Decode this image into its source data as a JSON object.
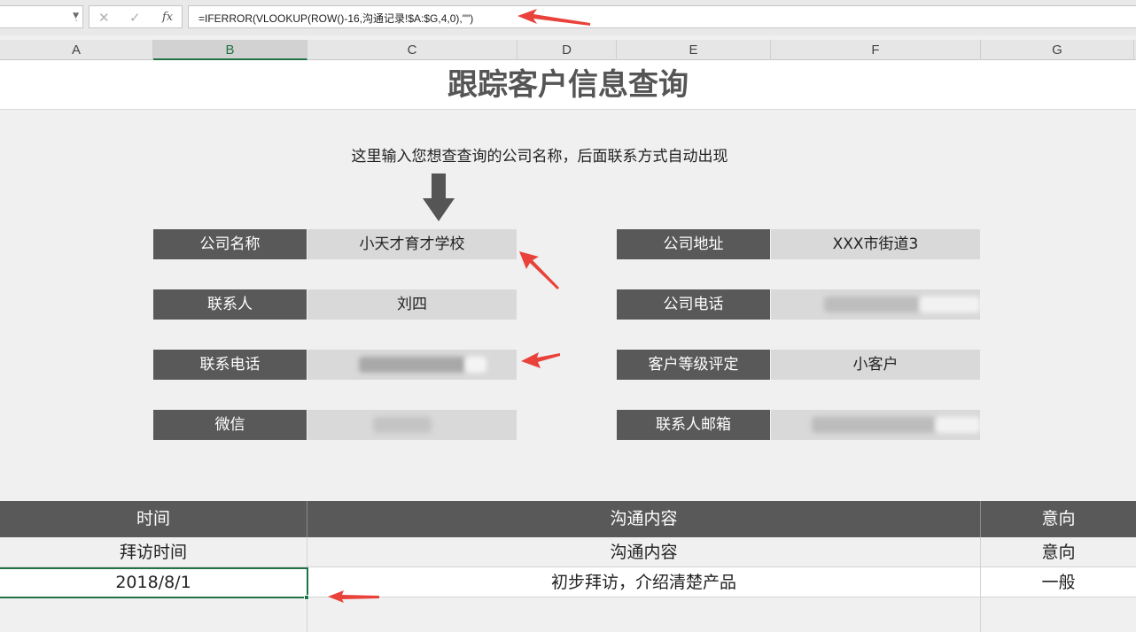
{
  "formula_bar": {
    "name_box": "",
    "cancel_icon": "cancel-x-icon",
    "enter_icon": "check-icon",
    "fx_label": "fx",
    "formula": "=IFERROR(VLOOKUP(ROW()-16,沟通记录!$A:$G,4,0),\"\")"
  },
  "columns": [
    "A",
    "B",
    "C",
    "D",
    "E",
    "F",
    "G"
  ],
  "sheet": {
    "title": "跟踪客户信息查询",
    "hint": "这里输入您想查查询的公司名称，后面联系方式自动出现",
    "left_fields": [
      {
        "label": "公司名称",
        "value": "小天才育才学校"
      },
      {
        "label": "联系人",
        "value": "刘四"
      },
      {
        "label": "联系电话",
        "value": ""
      },
      {
        "label": "微信",
        "value": ""
      }
    ],
    "right_fields": [
      {
        "label": "公司地址",
        "value": "XXX市街道3"
      },
      {
        "label": "公司电话",
        "value": ""
      },
      {
        "label": "客户等级评定",
        "value": "小客户"
      },
      {
        "label": "联系人邮箱",
        "value": ""
      }
    ]
  },
  "table": {
    "headers": [
      "时间",
      "沟通内容",
      "意向"
    ],
    "rows": [
      [
        "拜访时间",
        "沟通内容",
        "意向"
      ],
      [
        "2018/8/1",
        "初步拜访，介绍清楚产品",
        "一般"
      ]
    ]
  },
  "colors": {
    "header_dark": "#595959",
    "value_bg": "#d9d9d9",
    "excel_green": "#217346",
    "annotation_red": "#e8423a"
  }
}
